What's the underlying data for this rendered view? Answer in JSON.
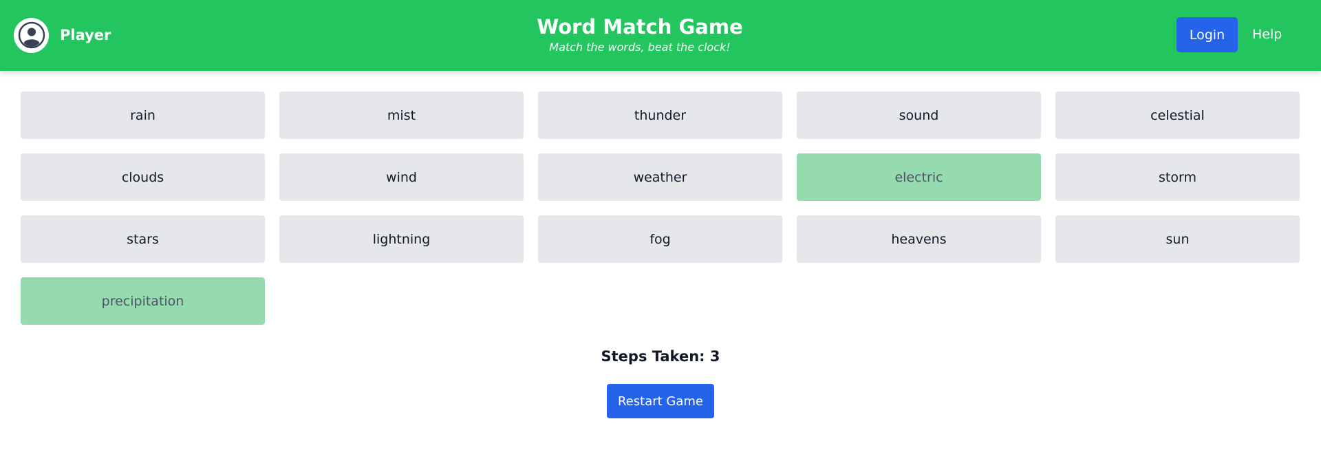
{
  "header": {
    "player_name": "Player",
    "title": "Word Match Game",
    "subtitle": "Match the words, beat the clock!",
    "login_label": "Login",
    "help_label": "Help",
    "avatar_icon": "user-circle-icon"
  },
  "colors": {
    "header_bg": "#22c55e",
    "primary_button": "#2563eb",
    "card_default": "#e5e7eb",
    "card_matched": "#96dbb0"
  },
  "cards": [
    {
      "word": "rain",
      "state": "default"
    },
    {
      "word": "mist",
      "state": "default"
    },
    {
      "word": "thunder",
      "state": "default"
    },
    {
      "word": "sound",
      "state": "default"
    },
    {
      "word": "celestial",
      "state": "default"
    },
    {
      "word": "clouds",
      "state": "default"
    },
    {
      "word": "wind",
      "state": "default"
    },
    {
      "word": "weather",
      "state": "default"
    },
    {
      "word": "electric",
      "state": "matched"
    },
    {
      "word": "storm",
      "state": "default"
    },
    {
      "word": "stars",
      "state": "default"
    },
    {
      "word": "lightning",
      "state": "default"
    },
    {
      "word": "fog",
      "state": "default"
    },
    {
      "word": "heavens",
      "state": "default"
    },
    {
      "word": "sun",
      "state": "default"
    },
    {
      "word": "precipitation",
      "state": "matched"
    }
  ],
  "status": {
    "steps_label": "Steps Taken: 3"
  },
  "controls": {
    "restart_label": "Restart Game"
  }
}
